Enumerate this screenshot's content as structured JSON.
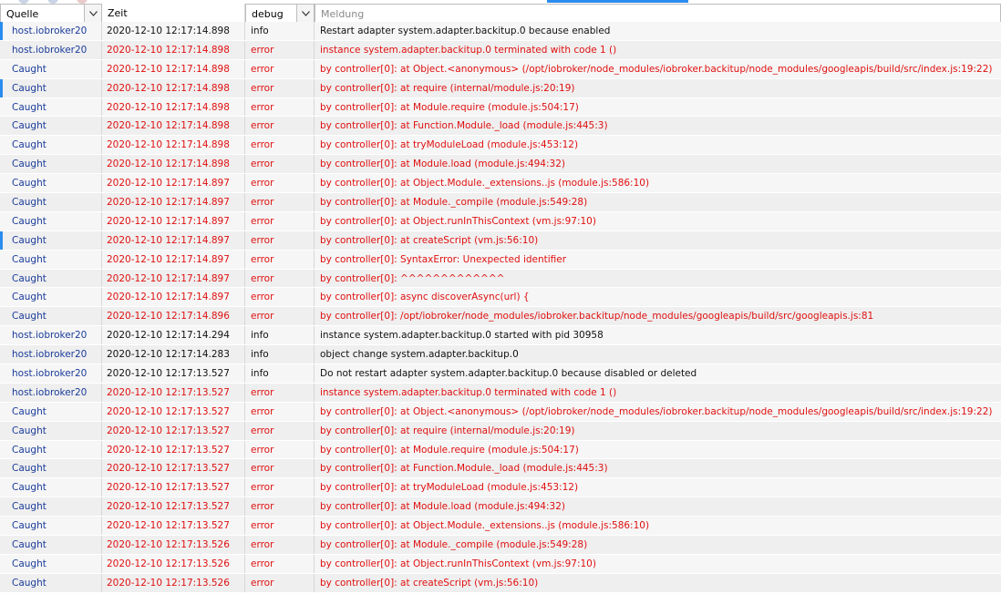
{
  "header": {
    "source_label": "Quelle",
    "time_label": "Zeit",
    "severity_value": "debug",
    "message_placeholder": "Meldung"
  },
  "colors": {
    "source_text": "#1a3c9a",
    "error_text": "#e01010",
    "info_text": "#111111",
    "row_marker": "#2a8cf0"
  },
  "rows": [
    {
      "source": "host.iobroker20",
      "time": "2020-12-10 12:17:14.898",
      "severity": "info",
      "message": "Restart adapter system.adapter.backitup.0 because enabled"
    },
    {
      "source": "host.iobroker20",
      "time": "2020-12-10 12:17:14.898",
      "severity": "error",
      "message": "instance system.adapter.backitup.0 terminated with code 1 ()"
    },
    {
      "source": "Caught",
      "time": "2020-12-10 12:17:14.898",
      "severity": "error",
      "message": "by controller[0]: at Object.<anonymous> (/opt/iobroker/node_modules/iobroker.backitup/node_modules/googleapis/build/src/index.js:19:22)"
    },
    {
      "source": "Caught",
      "time": "2020-12-10 12:17:14.898",
      "severity": "error",
      "message": "by controller[0]: at require (internal/module.js:20:19)"
    },
    {
      "source": "Caught",
      "time": "2020-12-10 12:17:14.898",
      "severity": "error",
      "message": "by controller[0]: at Module.require (module.js:504:17)"
    },
    {
      "source": "Caught",
      "time": "2020-12-10 12:17:14.898",
      "severity": "error",
      "message": "by controller[0]: at Function.Module._load (module.js:445:3)"
    },
    {
      "source": "Caught",
      "time": "2020-12-10 12:17:14.898",
      "severity": "error",
      "message": "by controller[0]: at tryModuleLoad (module.js:453:12)"
    },
    {
      "source": "Caught",
      "time": "2020-12-10 12:17:14.898",
      "severity": "error",
      "message": "by controller[0]: at Module.load (module.js:494:32)"
    },
    {
      "source": "Caught",
      "time": "2020-12-10 12:17:14.897",
      "severity": "error",
      "message": "by controller[0]: at Object.Module._extensions..js (module.js:586:10)"
    },
    {
      "source": "Caught",
      "time": "2020-12-10 12:17:14.897",
      "severity": "error",
      "message": "by controller[0]: at Module._compile (module.js:549:28)"
    },
    {
      "source": "Caught",
      "time": "2020-12-10 12:17:14.897",
      "severity": "error",
      "message": "by controller[0]: at Object.runInThisContext (vm.js:97:10)"
    },
    {
      "source": "Caught",
      "time": "2020-12-10 12:17:14.897",
      "severity": "error",
      "message": "by controller[0]: at createScript (vm.js:56:10)"
    },
    {
      "source": "Caught",
      "time": "2020-12-10 12:17:14.897",
      "severity": "error",
      "message": "by controller[0]: SyntaxError: Unexpected identifier"
    },
    {
      "source": "Caught",
      "time": "2020-12-10 12:17:14.897",
      "severity": "error",
      "message": "by controller[0]: ^^^^^^^^^^^^^"
    },
    {
      "source": "Caught",
      "time": "2020-12-10 12:17:14.897",
      "severity": "error",
      "message": "by controller[0]: async discoverAsync(url) {"
    },
    {
      "source": "Caught",
      "time": "2020-12-10 12:17:14.896",
      "severity": "error",
      "message": "by controller[0]: /opt/iobroker/node_modules/iobroker.backitup/node_modules/googleapis/build/src/googleapis.js:81"
    },
    {
      "source": "host.iobroker20",
      "time": "2020-12-10 12:17:14.294",
      "severity": "info",
      "message": "instance system.adapter.backitup.0 started with pid 30958"
    },
    {
      "source": "host.iobroker20",
      "time": "2020-12-10 12:17:14.283",
      "severity": "info",
      "message": "object change system.adapter.backitup.0"
    },
    {
      "source": "host.iobroker20",
      "time": "2020-12-10 12:17:13.527",
      "severity": "info",
      "message": "Do not restart adapter system.adapter.backitup.0 because disabled or deleted"
    },
    {
      "source": "host.iobroker20",
      "time": "2020-12-10 12:17:13.527",
      "severity": "error",
      "message": "instance system.adapter.backitup.0 terminated with code 1 ()"
    },
    {
      "source": "Caught",
      "time": "2020-12-10 12:17:13.527",
      "severity": "error",
      "message": "by controller[0]: at Object.<anonymous> (/opt/iobroker/node_modules/iobroker.backitup/node_modules/googleapis/build/src/index.js:19:22)"
    },
    {
      "source": "Caught",
      "time": "2020-12-10 12:17:13.527",
      "severity": "error",
      "message": "by controller[0]: at require (internal/module.js:20:19)"
    },
    {
      "source": "Caught",
      "time": "2020-12-10 12:17:13.527",
      "severity": "error",
      "message": "by controller[0]: at Module.require (module.js:504:17)"
    },
    {
      "source": "Caught",
      "time": "2020-12-10 12:17:13.527",
      "severity": "error",
      "message": "by controller[0]: at Function.Module._load (module.js:445:3)"
    },
    {
      "source": "Caught",
      "time": "2020-12-10 12:17:13.527",
      "severity": "error",
      "message": "by controller[0]: at tryModuleLoad (module.js:453:12)"
    },
    {
      "source": "Caught",
      "time": "2020-12-10 12:17:13.527",
      "severity": "error",
      "message": "by controller[0]: at Module.load (module.js:494:32)"
    },
    {
      "source": "Caught",
      "time": "2020-12-10 12:17:13.527",
      "severity": "error",
      "message": "by controller[0]: at Object.Module._extensions..js (module.js:586:10)"
    },
    {
      "source": "Caught",
      "time": "2020-12-10 12:17:13.526",
      "severity": "error",
      "message": "by controller[0]: at Module._compile (module.js:549:28)"
    },
    {
      "source": "Caught",
      "time": "2020-12-10 12:17:13.526",
      "severity": "error",
      "message": "by controller[0]: at Object.runInThisContext (vm.js:97:10)"
    },
    {
      "source": "Caught",
      "time": "2020-12-10 12:17:13.526",
      "severity": "error",
      "message": "by controller[0]: at createScript (vm.js:56:10)"
    }
  ]
}
